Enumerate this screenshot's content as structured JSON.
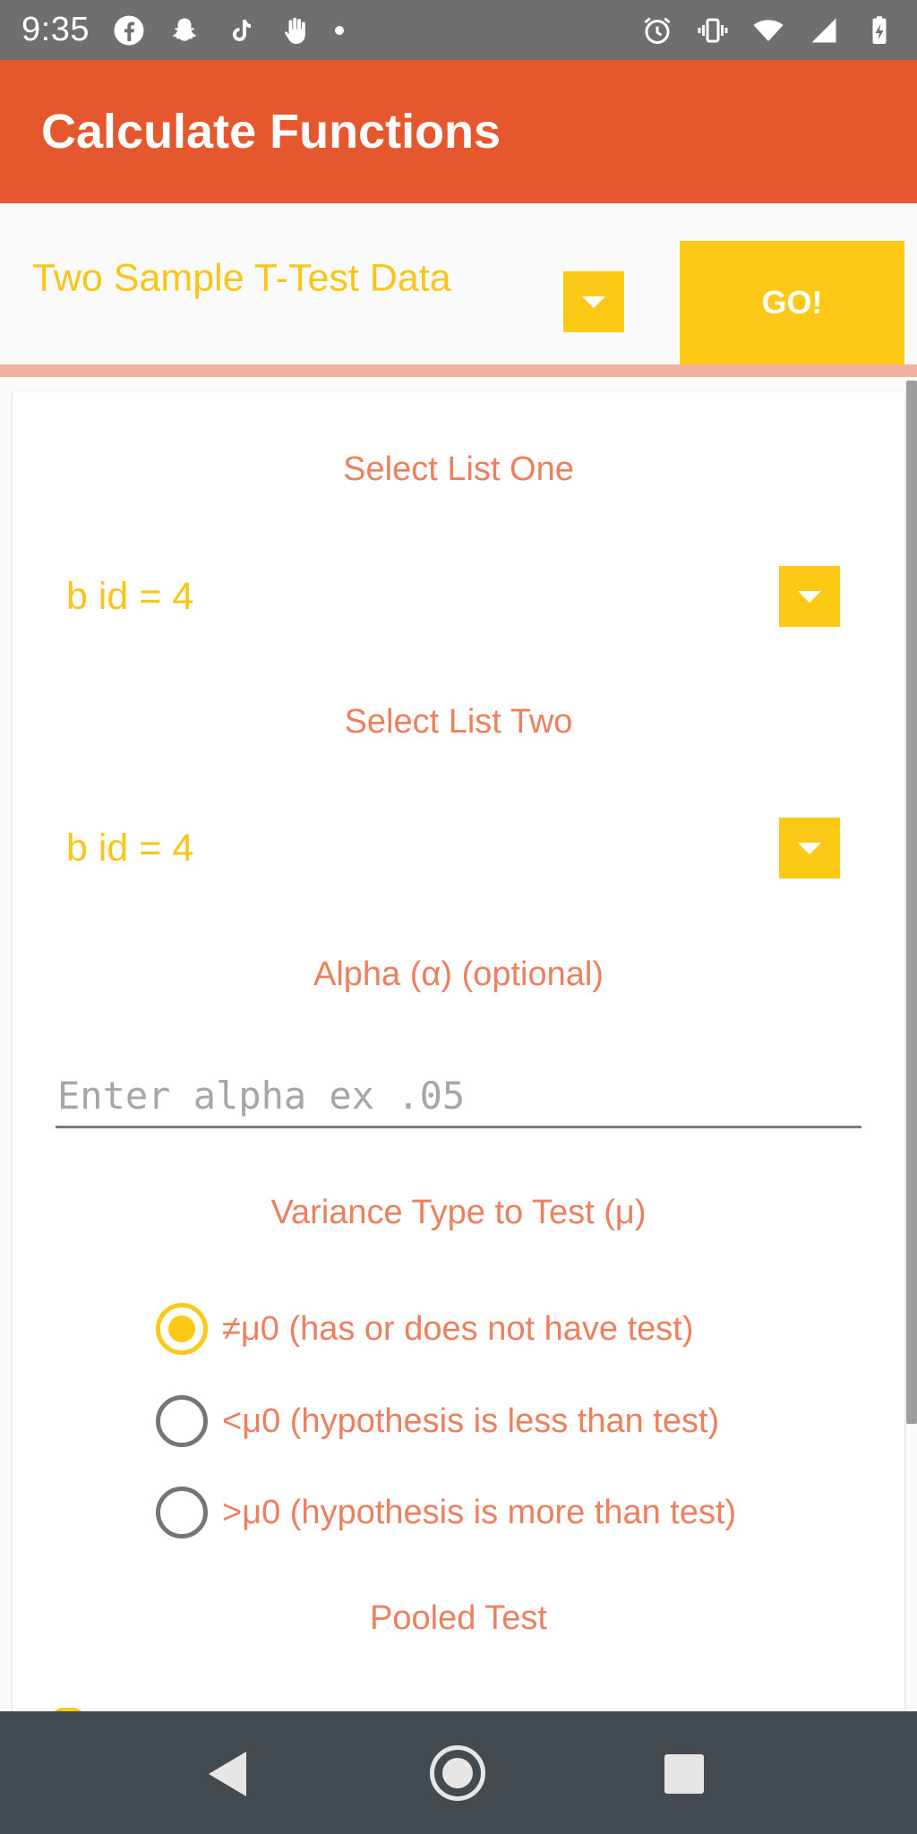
{
  "status_bar": {
    "time": "9:35",
    "left_icons": [
      "facebook-icon",
      "snapchat-icon",
      "tiktok-icon",
      "hand-icon",
      "dot-icon"
    ],
    "right_icons": [
      "alarm-icon",
      "vibrate-icon",
      "wifi-icon",
      "signal-icon",
      "battery-charging-icon"
    ]
  },
  "app_bar": {
    "title": "Calculate Functions"
  },
  "function_selector": {
    "selected": "Two Sample T-Test Data",
    "go_label": "GO!"
  },
  "form": {
    "list_one_label": "Select List One",
    "list_one_value": "b id = 4",
    "list_two_label": "Select List Two",
    "list_two_value": "b id = 4",
    "alpha_label": "Alpha (α) (optional)",
    "alpha_placeholder": "Enter alpha ex .05",
    "alpha_value": "",
    "variance_label": "Variance Type to Test (μ)",
    "variance_options": [
      {
        "label": "≠μ0 (has or does not have test)",
        "checked": true
      },
      {
        "label": "<μ0 (hypothesis is less than test)",
        "checked": false
      },
      {
        "label": ">μ0 (hypothesis is more than test)",
        "checked": false
      }
    ],
    "pooled_label": "Pooled Test"
  },
  "colors": {
    "app_bar": "#e5572d",
    "accent_yellow": "#fcc917",
    "label_orange": "#ec7f5e",
    "nav_bar": "#434a50",
    "status_bar": "#6f6f6f"
  }
}
